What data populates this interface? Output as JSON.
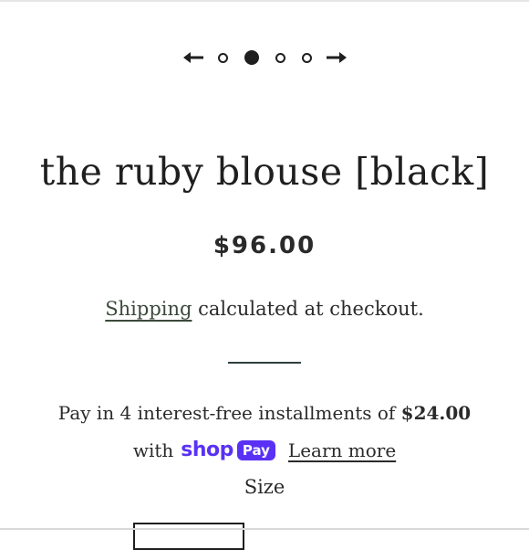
{
  "slider": {
    "prev_icon": "arrow-left-icon",
    "next_icon": "arrow-right-icon",
    "dot_count": 4,
    "active_dot": 2
  },
  "product": {
    "title": "the ruby blouse [black]",
    "price": "$96.00"
  },
  "shipping": {
    "link_label": "Shipping",
    "rest": " calculated at checkout."
  },
  "installments": {
    "text": "Pay in 4 interest-free installments of ",
    "amount": "$24.00",
    "with_label": "with",
    "shop_word": "shop",
    "pay_word": "Pay",
    "learn_more": "Learn more"
  },
  "size": {
    "label": "Size"
  },
  "colors": {
    "text": "#1f1f1f",
    "shop_pay_purple": "#5a31f4",
    "link_green": "#3b4a3b"
  }
}
